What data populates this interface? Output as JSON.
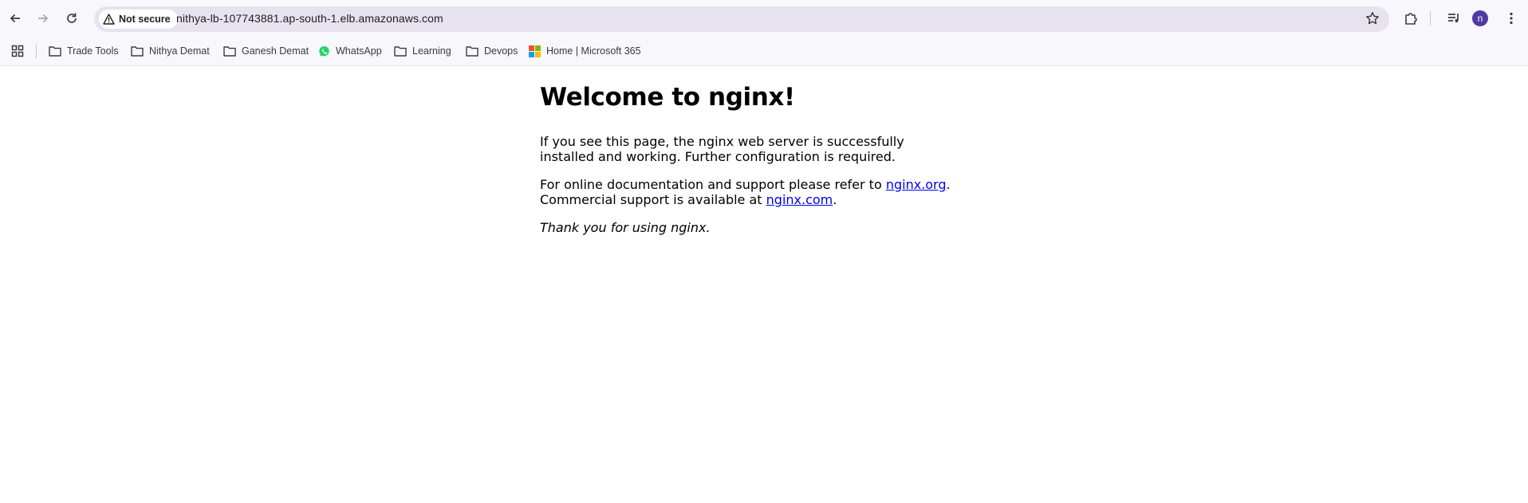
{
  "browser": {
    "security_label": "Not secure",
    "url": "nithya-lb-107743881.ap-south-1.elb.amazonaws.com",
    "profile_initial": "n",
    "accent": "#4f3aa3"
  },
  "bookmarks": [
    {
      "label": "Trade Tools",
      "icon": "folder-icon"
    },
    {
      "label": "Nithya Demat",
      "icon": "folder-icon"
    },
    {
      "label": "Ganesh Demat",
      "icon": "folder-icon"
    },
    {
      "label": "WhatsApp",
      "icon": "whatsapp-icon"
    },
    {
      "label": "Learning",
      "icon": "folder-icon"
    },
    {
      "label": "Devops",
      "icon": "folder-icon"
    },
    {
      "label": "Home | Microsoft 365",
      "icon": "microsoft-icon"
    }
  ],
  "page": {
    "heading": "Welcome to nginx!",
    "p1": "If you see this page, the nginx web server is successfully installed and working. Further configuration is required.",
    "p2_prefix": "For online documentation and support please refer to ",
    "link_org": "nginx.org",
    "p2_mid": ".",
    "p2_line2": "Commercial support is available at ",
    "link_com": "nginx.com",
    "p2_end": ".",
    "thanks": "Thank you for using nginx."
  }
}
